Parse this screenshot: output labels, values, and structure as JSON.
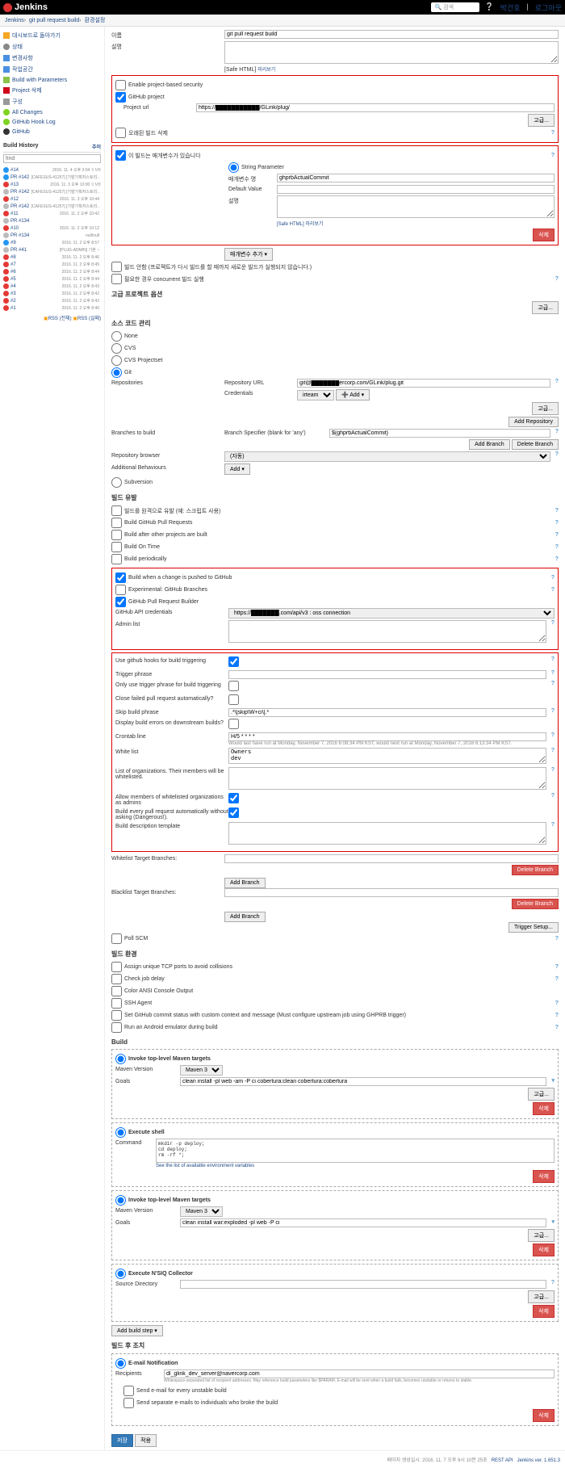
{
  "header": {
    "logo": "Jenkins",
    "search_ph": "검색",
    "user": "박건호",
    "logout": "로그아웃"
  },
  "breadcrumb": [
    "Jenkins",
    "git pull request build",
    "환경설정"
  ],
  "sidebar": {
    "nav": [
      {
        "icon": "i-home",
        "label": "대시보드로 돌아가기"
      },
      {
        "icon": "i-clock",
        "label": "상태"
      },
      {
        "icon": "i-doc",
        "label": "변경사항"
      },
      {
        "icon": "i-doc",
        "label": "작업공간"
      },
      {
        "icon": "i-build",
        "label": "Build with Parameters"
      },
      {
        "icon": "i-del",
        "label": "Project 삭제"
      },
      {
        "icon": "i-gear",
        "label": "구성"
      },
      {
        "icon": "i-log",
        "label": "All Changes"
      },
      {
        "icon": "i-log",
        "label": "GitHub Hook Log"
      },
      {
        "icon": "i-gh",
        "label": "GitHub"
      }
    ],
    "history_title": "Build History",
    "history_sub": "추이",
    "find_ph": "find",
    "builds": [
      {
        "b": "blue",
        "name": "#14",
        "date": "2016. 11. 4 오후 2:04",
        "size": "9 MB"
      },
      {
        "b": "blue",
        "name": "PR #142",
        "date": "[CAFESUS-41257] [기발기획자스토리..",
        "size": ""
      },
      {
        "b": "red",
        "name": "#13",
        "date": "2016. 11. 3 오후 10:00",
        "size": "9 MB"
      },
      {
        "b": "gray",
        "name": "PR #142",
        "date": "[CAFESUS-41257] [기발기획자스토리..",
        "size": ""
      },
      {
        "b": "red",
        "name": "#12",
        "date": "2016. 11. 3 오후 10:44",
        "size": ""
      },
      {
        "b": "gray",
        "name": "PR #142",
        "date": "[CAFESUS-41257] [기발기획자스토리..",
        "size": ""
      },
      {
        "b": "red",
        "name": "#11",
        "date": "2016. 11. 2 오후 10:42",
        "size": ""
      },
      {
        "b": "gray",
        "name": "PR #134",
        "date": "",
        "size": ""
      },
      {
        "b": "red",
        "name": "#10",
        "date": "2016. 11. 2 오후 10:12",
        "size": ""
      },
      {
        "b": "gray",
        "name": "PR #134",
        "date": "null/null",
        "size": ""
      },
      {
        "b": "blue",
        "name": "#9",
        "date": "2016. 11. 2 오후 8:57",
        "size": ""
      },
      {
        "b": "gray",
        "name": "PR #41",
        "date": "[PLUG-ADMIN] 기본 ~",
        "size": ""
      },
      {
        "b": "red",
        "name": "#8",
        "date": "2016. 11. 2 오후 8:46",
        "size": ""
      },
      {
        "b": "red",
        "name": "#7",
        "date": "2016. 11. 2 오후 8:45",
        "size": ""
      },
      {
        "b": "red",
        "name": "#6",
        "date": "2016. 11. 2 오후 8:44",
        "size": ""
      },
      {
        "b": "red",
        "name": "#5",
        "date": "2016. 11. 2 오후 8:44",
        "size": ""
      },
      {
        "b": "red",
        "name": "#4",
        "date": "2016. 11. 2 오후 8:43",
        "size": ""
      },
      {
        "b": "red",
        "name": "#3",
        "date": "2016. 11. 2 오후 8:42",
        "size": ""
      },
      {
        "b": "red",
        "name": "#2",
        "date": "2016. 11. 2 오후 8:42",
        "size": ""
      },
      {
        "b": "red",
        "name": "#1",
        "date": "2016. 11. 2 오후 8:40",
        "size": ""
      }
    ],
    "rss_all": "RSS (전체)",
    "rss_fail": "RSS (실패)"
  },
  "form": {
    "name_lbl": "이름",
    "name_val": "git pull request build",
    "desc_lbl": "설명",
    "safe_html": "[Safe HTML]",
    "preview": "미리보기",
    "security_chk": "Enable project-based security",
    "github_proj_chk": "GitHub project",
    "project_url_lbl": "Project url",
    "project_url_val": "https://███████████/GLink/plug/",
    "adv_btn": "고급...",
    "old_build_del": "오래된 빌드 삭제",
    "param_chk": "이 빌드는 매개변수가 있습니다",
    "string_param": "String Parameter",
    "param_name_lbl": "매개변수 명",
    "param_name_val": "ghprbActualCommit",
    "default_val_lbl": "Default Value",
    "param_desc_lbl": "설명",
    "safe_html2": "[Safe HTML] 미리보기",
    "del_btn": "삭제",
    "add_param_btn": "매개변수 추가 ▾",
    "disable_build": "빌드 안함 (프로젝트가 다시 빌드를 할 때까지 새로운 빌드가 실행되지 않습니다.)",
    "concurrent": "필요한 경우 concurrent 빌드 실행",
    "adv_opts": "고급 프로젝트 옵션",
    "scm_title": "소스 코드 관리",
    "scm": {
      "none": "None",
      "cvs": "CVS",
      "cvsps": "CVS Projectset",
      "git": "Git"
    },
    "repos_lbl": "Repositories",
    "repo_url_lbl": "Repository URL",
    "repo_url_val": "git@███████ercorp.com/GLink/plug.git",
    "cred_lbl": "Credentials",
    "cred_val": "irteam",
    "cred_add": "➕ Add ▾",
    "add_repo_btn": "Add Repository",
    "branches_lbl": "Branches to build",
    "branch_spec_lbl": "Branch Specifier (blank for 'any')",
    "branch_spec_val": "${ghprbActualCommit}",
    "add_branch_btn": "Add Branch",
    "del_branch_btn": "Delete Branch",
    "repo_browser_lbl": "Repository browser",
    "repo_browser_val": "(자동)",
    "add_behav_lbl": "Additional Behaviours",
    "add_btn": "Add ▾",
    "subversion": "Subversion",
    "trigger_title": "빌드 유발",
    "triggers": {
      "remote": "빌드를 원격으로 유발 (예: 스크립트 사용)",
      "ghpr": "Build GitHub Pull Requests",
      "after": "Build after other projects are built",
      "time": "Build On Time",
      "period": "Build periodically",
      "push": "Build when a change is pushed to GitHub",
      "exp": "Experimental: GitHub Branches",
      "ghprb": "GitHub Pull Request Builder"
    },
    "gh_api_lbl": "GitHub API credentials",
    "gh_api_val": "https://███████.com/api/v3 : oss connection",
    "admin_list_lbl": "Admin list",
    "ghhooks": "Use github hooks for build triggering",
    "trig_phrase_lbl": "Trigger phrase",
    "only_trig": "Only use trigger phrase for build triggering",
    "close_fail": "Close failed pull request automatically?",
    "skip_phrase_lbl": "Skip build phrase",
    "skip_phrase_val": ".*\\[skip\\W+ci\\].*",
    "disp_err": "Display build errors on downstream builds?",
    "crontab_lbl": "Crontab line",
    "crontab_val": "H/5 * * * *",
    "crontab_note": "Would last have run at Monday, November 7, 2016 6:08:34 PM KST; would next run at Monday, November 7, 2016 6:13:34 PM KST.",
    "whitelist_lbl": "White list",
    "whitelist_val": "Owners\ndev",
    "org_lbl": "List of organizations. Their members will be whitelisted.",
    "allow_admin": "Allow members of whitelisted organizations as admins",
    "auto_build": "Build every pull request automatically without asking (Dangerous!).",
    "build_desc_lbl": "Build description template",
    "wl_target_lbl": "Whitelist Target Branches:",
    "bl_target_lbl": "Blacklist Target Branches:",
    "trigger_setup_btn": "Trigger Setup...",
    "poll_scm": "Poll SCM",
    "env_title": "빌드 환경",
    "env": {
      "tcp": "Assign unique TCP ports to avoid collisions",
      "delay": "Check job delay",
      "ansi": "Color ANSI Console Output",
      "ssh": "SSH Agent",
      "ghstatus": "Set GitHub commit status with custom context and message (Must configure upstream job using GHPRB trigger)",
      "android": "Run an Android emulator during build"
    },
    "build_title": "Build",
    "maven_title": "Invoke top-level Maven targets",
    "maven_ver_lbl": "Maven Version",
    "maven_ver": "Maven 3",
    "goals_lbl": "Goals",
    "goals1": "clean install -pl web -am -P ci cobertura:clean cobertura:cobertura",
    "shell_title": "Execute shell",
    "cmd_lbl": "Command",
    "cmd_val": "mkdir -p deploy;\ncd deploy;\nrm -rf *;",
    "shell_note": "See the list of available environment variables",
    "goals2": "clean install war:exploded -pl web -P ci",
    "nsiq_title": "Execute N'SIQ Collector",
    "src_dir_lbl": "Source Directory",
    "add_step_btn": "Add build step ▾",
    "post_title": "빌드 후 조치",
    "email_title": "E-mail Notification",
    "recip_lbl": "Recipients",
    "recip_val": "dl_glink_dev_server@navercorp.com",
    "recip_note": "Whitespace-separated list of recipient addresses. May reference build parameters like $PARAM. E-mail will be sent when a build fails, becomes unstable or returns to stable.",
    "unstable": "Send e-mail for every unstable build",
    "individuals": "Send separate e-mails to individuals who broke the build",
    "save_btn": "저장",
    "apply_btn": "적용"
  },
  "footer": {
    "gen": "페이지 생성일시: 2016. 11. 7 오후 6시 10분 25초",
    "rest": "REST API",
    "ver": "Jenkins ver. 1.651.3"
  }
}
